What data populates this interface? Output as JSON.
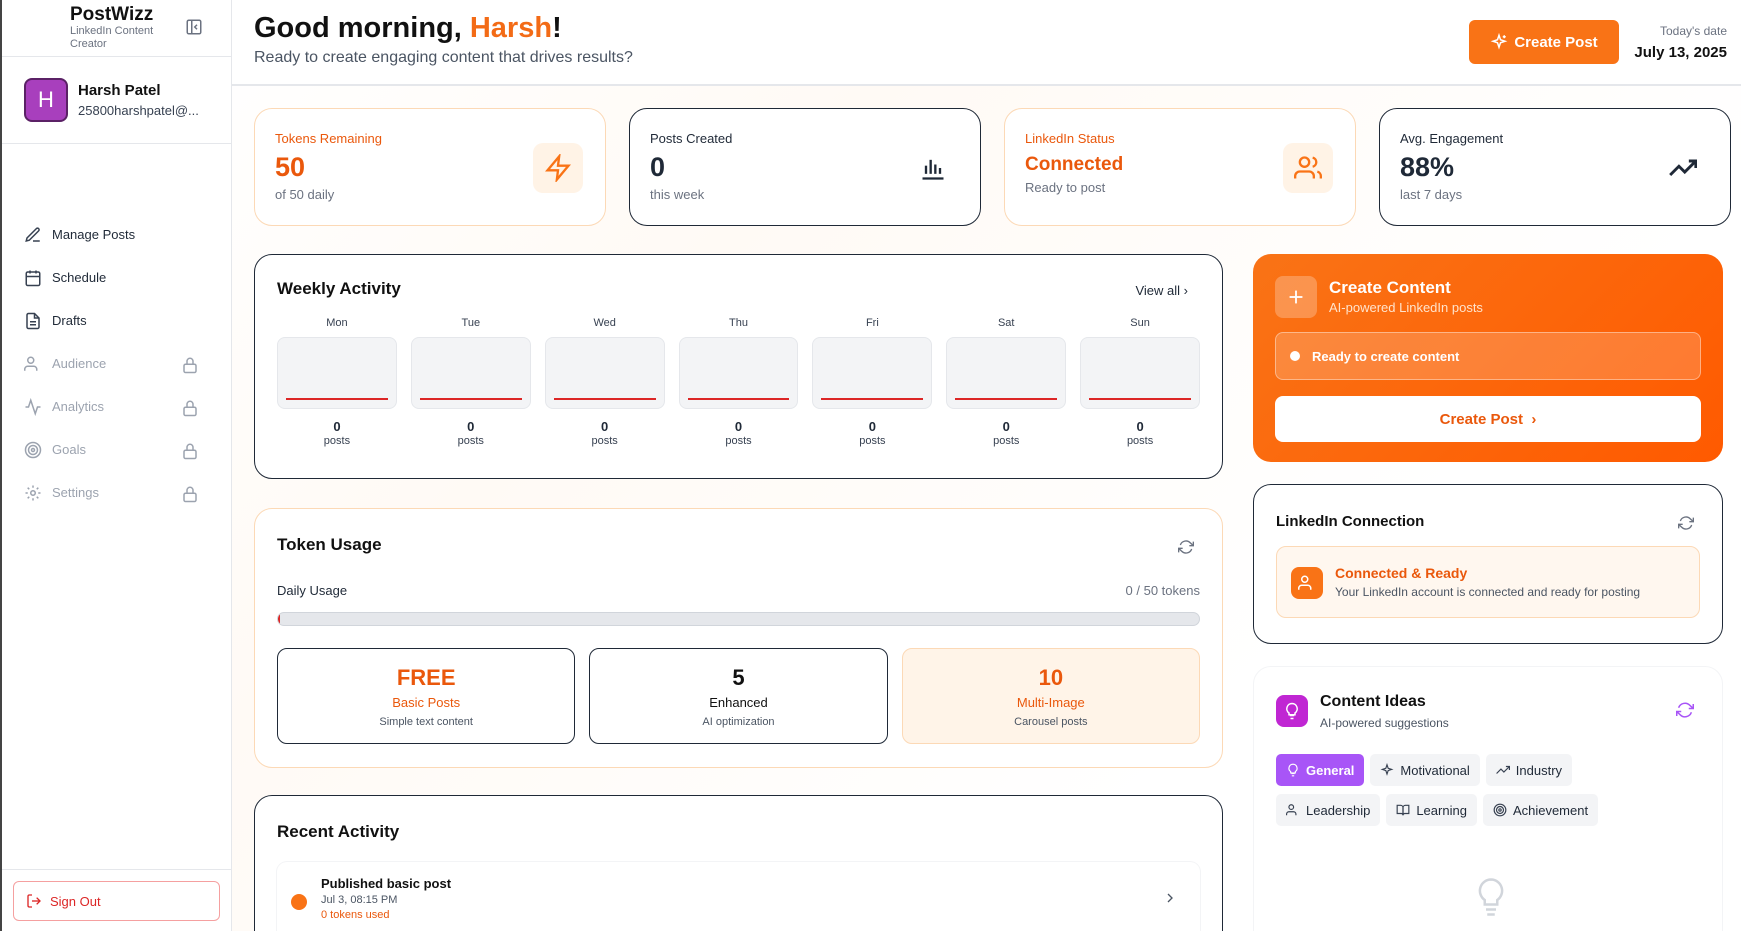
{
  "sidebar": {
    "brand": {
      "title": "PostWizz",
      "subtitle": "LinkedIn Content Creator"
    },
    "user": {
      "initial": "H",
      "name": "Harsh Patel",
      "email": "25800harshpatel@..."
    },
    "items": [
      {
        "label": "Manage Posts",
        "icon": "pencil-icon",
        "locked": false
      },
      {
        "label": "Schedule",
        "icon": "calendar-icon",
        "locked": false
      },
      {
        "label": "Drafts",
        "icon": "document-icon",
        "locked": false
      },
      {
        "label": "Audience",
        "icon": "users-icon",
        "locked": true
      },
      {
        "label": "Analytics",
        "icon": "activity-icon",
        "locked": true
      },
      {
        "label": "Goals",
        "icon": "target-icon",
        "locked": true
      },
      {
        "label": "Settings",
        "icon": "gear-icon",
        "locked": true
      }
    ],
    "signout": "Sign Out"
  },
  "header": {
    "greeting_prefix": "Good morning, ",
    "greeting_name": "Harsh",
    "greeting_suffix": "!",
    "subtitle": "Ready to create engaging content that drives results?",
    "create_button": "Create Post",
    "date_label": "Today's date",
    "date_value": "July 13, 2025"
  },
  "stats": [
    {
      "label": "Tokens Remaining",
      "value": "50",
      "sub": "of 50 daily",
      "style": "orange",
      "icon": "lightning-icon"
    },
    {
      "label": "Posts Created",
      "value": "0",
      "sub": "this week",
      "style": "dark",
      "icon": "bar-chart-icon"
    },
    {
      "label": "LinkedIn Status",
      "value": "Connected",
      "sub": "Ready to post",
      "style": "orange",
      "icon": "users-icon"
    },
    {
      "label": "Avg. Engagement",
      "value": "88%",
      "sub": "last 7 days",
      "style": "dark",
      "icon": "trending-up-icon"
    }
  ],
  "weekly": {
    "title": "Weekly Activity",
    "view_all": "View all",
    "unit": "posts",
    "days": [
      {
        "name": "Mon",
        "count": "0"
      },
      {
        "name": "Tue",
        "count": "0"
      },
      {
        "name": "Wed",
        "count": "0"
      },
      {
        "name": "Thu",
        "count": "0"
      },
      {
        "name": "Fri",
        "count": "0"
      },
      {
        "name": "Sat",
        "count": "0"
      },
      {
        "name": "Sun",
        "count": "0"
      }
    ]
  },
  "token_usage": {
    "title": "Token Usage",
    "daily_label": "Daily Usage",
    "daily_value": "0 / 50 tokens",
    "used_fraction": 0.0,
    "plans": [
      {
        "value": "FREE",
        "name": "Basic Posts",
        "desc": "Simple text content",
        "style": "orange"
      },
      {
        "value": "5",
        "name": "Enhanced",
        "desc": "AI optimization",
        "style": "dark"
      },
      {
        "value": "10",
        "name": "Multi-Image",
        "desc": "Carousel posts",
        "style": "hl"
      }
    ]
  },
  "recent": {
    "title": "Recent Activity",
    "items": [
      {
        "title": "Published basic post",
        "time": "Jul 3, 08:15 PM",
        "tokens": "0 tokens used"
      }
    ]
  },
  "create_content": {
    "title": "Create Content",
    "subtitle": "AI-powered LinkedIn posts",
    "status": "Ready to create content",
    "button": "Create Post"
  },
  "linkedin": {
    "title": "LinkedIn Connection",
    "status": "Connected & Ready",
    "desc": "Your LinkedIn account is connected and ready for posting"
  },
  "ideas": {
    "title": "Content Ideas",
    "subtitle": "AI-powered suggestions",
    "chips": [
      {
        "label": "General",
        "active": true
      },
      {
        "label": "Motivational",
        "active": false
      },
      {
        "label": "Industry",
        "active": false
      },
      {
        "label": "Leadership",
        "active": false
      },
      {
        "label": "Learning",
        "active": false
      },
      {
        "label": "Achievement",
        "active": false
      }
    ]
  },
  "colors": {
    "accent": "#f97316",
    "accent_dark": "#ea580c",
    "purple": "#a855f7"
  }
}
